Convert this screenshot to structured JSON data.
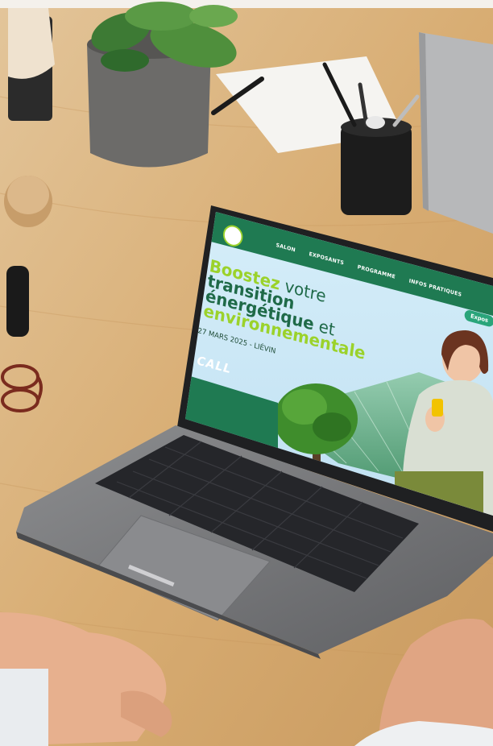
{
  "site": {
    "nav": [
      "SALON",
      "EXPOSANTS",
      "PROGRAMME",
      "INFOS PRATIQUES"
    ],
    "cta": "Expos",
    "headline": {
      "line1_accent": "Boostez",
      "line1_rest": " votre",
      "line2": "transition",
      "line3": "énergétique",
      "line3_rest": " et",
      "line4": "environnementale"
    },
    "event_info": "27 MARS 2025 - LIÉVIN",
    "partner_logo": "CALL"
  },
  "colors": {
    "desk": "#d9b27c",
    "brand_green": "#1f7a52",
    "accent_lime": "#9bd22b",
    "sky": "#cfe9f7",
    "laptop_body": "#7a7b7d",
    "keys": "#1e1f22"
  }
}
